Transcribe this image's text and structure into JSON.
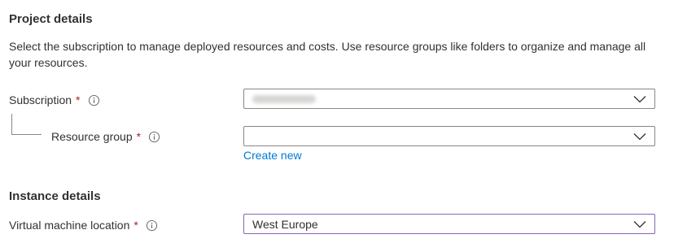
{
  "project_details": {
    "title": "Project details",
    "description": "Select the subscription to manage deployed resources and costs. Use resource groups like folders to organize and manage all your resources."
  },
  "subscription": {
    "label": "Subscription",
    "required_marker": "*",
    "info_icon": "info-icon",
    "value_redacted": true
  },
  "resource_group": {
    "label": "Resource group",
    "required_marker": "*",
    "info_icon": "info-icon",
    "value": "",
    "create_new_link": "Create new"
  },
  "instance_details": {
    "title": "Instance details"
  },
  "vm_location": {
    "label": "Virtual machine location",
    "required_marker": "*",
    "info_icon": "info-icon",
    "value": "West Europe"
  },
  "colors": {
    "text": "#323130",
    "required": "#a4262c",
    "link": "#0078d4",
    "border": "#8a8886",
    "focus_border": "#8764b8"
  }
}
